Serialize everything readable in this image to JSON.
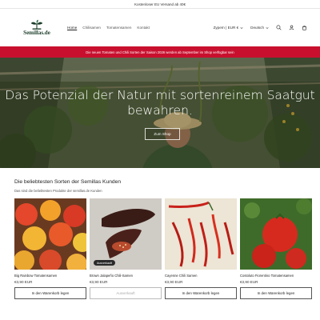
{
  "announcement_top": "Kostenloser EU Versand ab 40€",
  "logo": {
    "text": "Semillas.de"
  },
  "nav": [
    {
      "label": "Home",
      "active": true
    },
    {
      "label": "Chilisamen",
      "active": false
    },
    {
      "label": "Tomatensamen",
      "active": false
    },
    {
      "label": "Kontakt",
      "active": false
    }
  ],
  "header_right": {
    "country_currency": "Zypern | EUR €",
    "language": "Deutsch"
  },
  "announcement_red": "Die neuen Tomaten und Chili Sorten der Saison 2026 werden ab September im Shop verfügbar sein",
  "hero": {
    "title": "Das Potenzial der Natur mit sortenreinem Saatgut bewahren.",
    "button": "Zum Shop"
  },
  "featured": {
    "title": "Die beliebtesten Sorten der Semillas Kunden",
    "subtitle": "Das sind die beliebtesten Produkte der semillas.de Kunden",
    "products": [
      {
        "name": "Big Rainbow Tomatensamen",
        "price": "€3,90 EUR",
        "button": "In den Warenkorb legen",
        "sold_out": false,
        "badge": ""
      },
      {
        "name": "Brown Jalapeño Chili-Samen",
        "price": "€3,90 EUR",
        "button": "Ausverkauft",
        "sold_out": true,
        "badge": "Ausverkauft"
      },
      {
        "name": "Cayenne Chili Samen",
        "price": "€3,90 EUR",
        "button": "In den Warenkorb legen",
        "sold_out": false,
        "badge": ""
      },
      {
        "name": "Costoluto Fiorentino Tomatensamen",
        "price": "€3,90 EUR",
        "button": "In den Warenkorb legen",
        "sold_out": false,
        "badge": ""
      }
    ]
  },
  "colors": {
    "accent_red": "#c8102e",
    "logo_green": "#1b3d2a"
  }
}
